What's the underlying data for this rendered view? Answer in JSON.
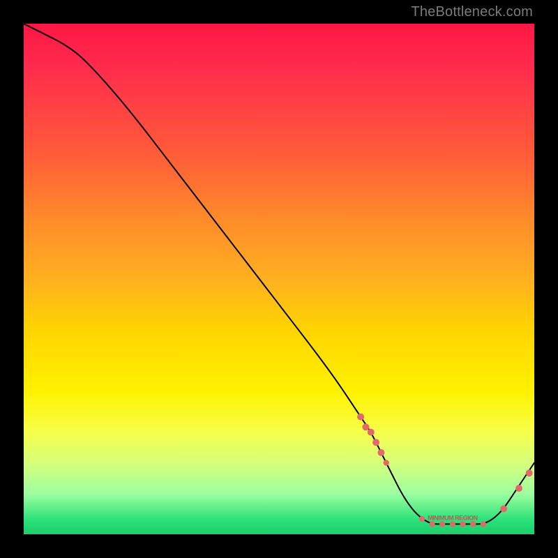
{
  "watermark": "TheBottleneck.com",
  "chart_data": {
    "type": "line",
    "title": "",
    "xlabel": "",
    "ylabel": "",
    "xlim": [
      0,
      100
    ],
    "ylim": [
      0,
      100
    ],
    "notes": "Background is a vertical red→yellow→green gradient with a black curve overlaid. Axis ticks and numeric labels are not shown; values below are estimated on a 0–100 normalized scale from curve geometry. Curve descends from top-left, reaches a flat minimum, then rises slightly near the right edge. Salmon markers cluster on the descending segment just before the trough, along the flat bottom, and on the rising tail.",
    "series": [
      {
        "name": "bottleneck_curve",
        "x": [
          0,
          4,
          8,
          12,
          20,
          30,
          40,
          50,
          60,
          66,
          68,
          70,
          72,
          74,
          76,
          78,
          80,
          82,
          84,
          86,
          88,
          90,
          92,
          94,
          96,
          98,
          100
        ],
        "y": [
          100,
          98,
          96,
          93,
          84,
          71,
          58,
          45,
          32,
          23,
          20,
          16,
          12,
          8,
          5,
          3,
          2,
          2,
          2,
          2,
          2,
          2,
          3,
          5,
          8,
          11,
          14
        ]
      }
    ],
    "markers": {
      "name": "highlight_points",
      "x": [
        66,
        67,
        68,
        69,
        70,
        71,
        78,
        80,
        82,
        84,
        86,
        88,
        90,
        94,
        97,
        99
      ],
      "y": [
        23,
        21,
        20,
        18,
        16,
        14,
        3,
        2,
        2,
        2,
        2,
        2,
        2,
        5,
        9,
        12
      ]
    },
    "flat_region_label": "MINIMUM REGION"
  },
  "colors": {
    "marker": "#e06a6a",
    "line": "#000000",
    "bg_top": "#ff1744",
    "bg_mid": "#fff200",
    "bg_bottom": "#18cf6c",
    "frame": "#000000",
    "watermark": "#7b7b7b"
  }
}
